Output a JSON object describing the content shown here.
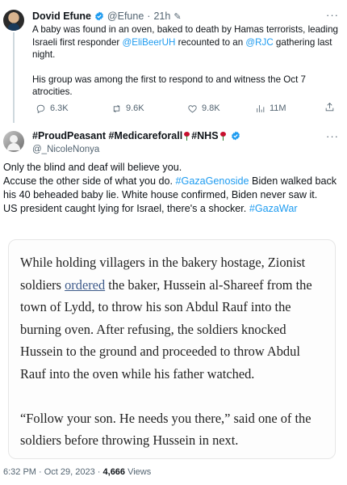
{
  "tweet1": {
    "author_name": "Dovid Efune",
    "handle": "@Efune",
    "separator": "·",
    "time": "21h",
    "body_p1_a": "A baby was found in an oven, baked to death by Hamas terrorists, leading Israeli first responder ",
    "body_p1_mention1": "@EliBeerUH",
    "body_p1_b": " recounted to an ",
    "body_p1_mention2": "@RJC",
    "body_p1_c": " gathering last night.",
    "body_p2": "His group was among the first to respond to and witness the Oct 7 atrocities.",
    "replies": "6.3K",
    "reposts": "9.6K",
    "likes": "9.8K",
    "views": "11M",
    "more": "···"
  },
  "tweet2": {
    "author_name_a": "#ProudPeasant #Medicareforall ",
    "author_name_b": " #NHS ",
    "handle": "@_NicoleNonya",
    "more": "···",
    "line1": "Only the blind and deaf will believe you.",
    "line2_a": "Accuse the other side of what you do. ",
    "line2_tag": "#GazaGenoside",
    "line2_b": " Biden walked back his 40 beheaded baby lie. White house confirmed, Biden never saw it.",
    "line3_a": "US president caught lying for Israel, there's a shocker. ",
    "line3_tag": "#GazaWar",
    "image_p1_a": "While holding villagers in the bakery hostage, Zionist soldiers ",
    "image_p1_link": "ordered",
    "image_p1_b": " the baker, Hussein al-Shareef from the town of Lydd, to throw his son Abdul Rauf into the burning oven. After refusing, the soldiers knocked Hussein to the ground and proceeded to throw Abdul Rauf into the oven while his father watched.",
    "image_p2": "“Follow your son. He needs you there,” said one of the soldiers before throwing Hussein in next.",
    "time": "6:32 PM · Oct 29, 2023 · ",
    "views_count": "4,666",
    "views_label": " Views"
  },
  "colors": {
    "link": "#1d9bf0",
    "muted": "#536471",
    "text": "#0f1419"
  },
  "icons": [
    "verified-badge-icon",
    "pencil-icon",
    "reply-icon",
    "repost-icon",
    "like-icon",
    "views-icon",
    "share-icon",
    "rose-icon"
  ]
}
